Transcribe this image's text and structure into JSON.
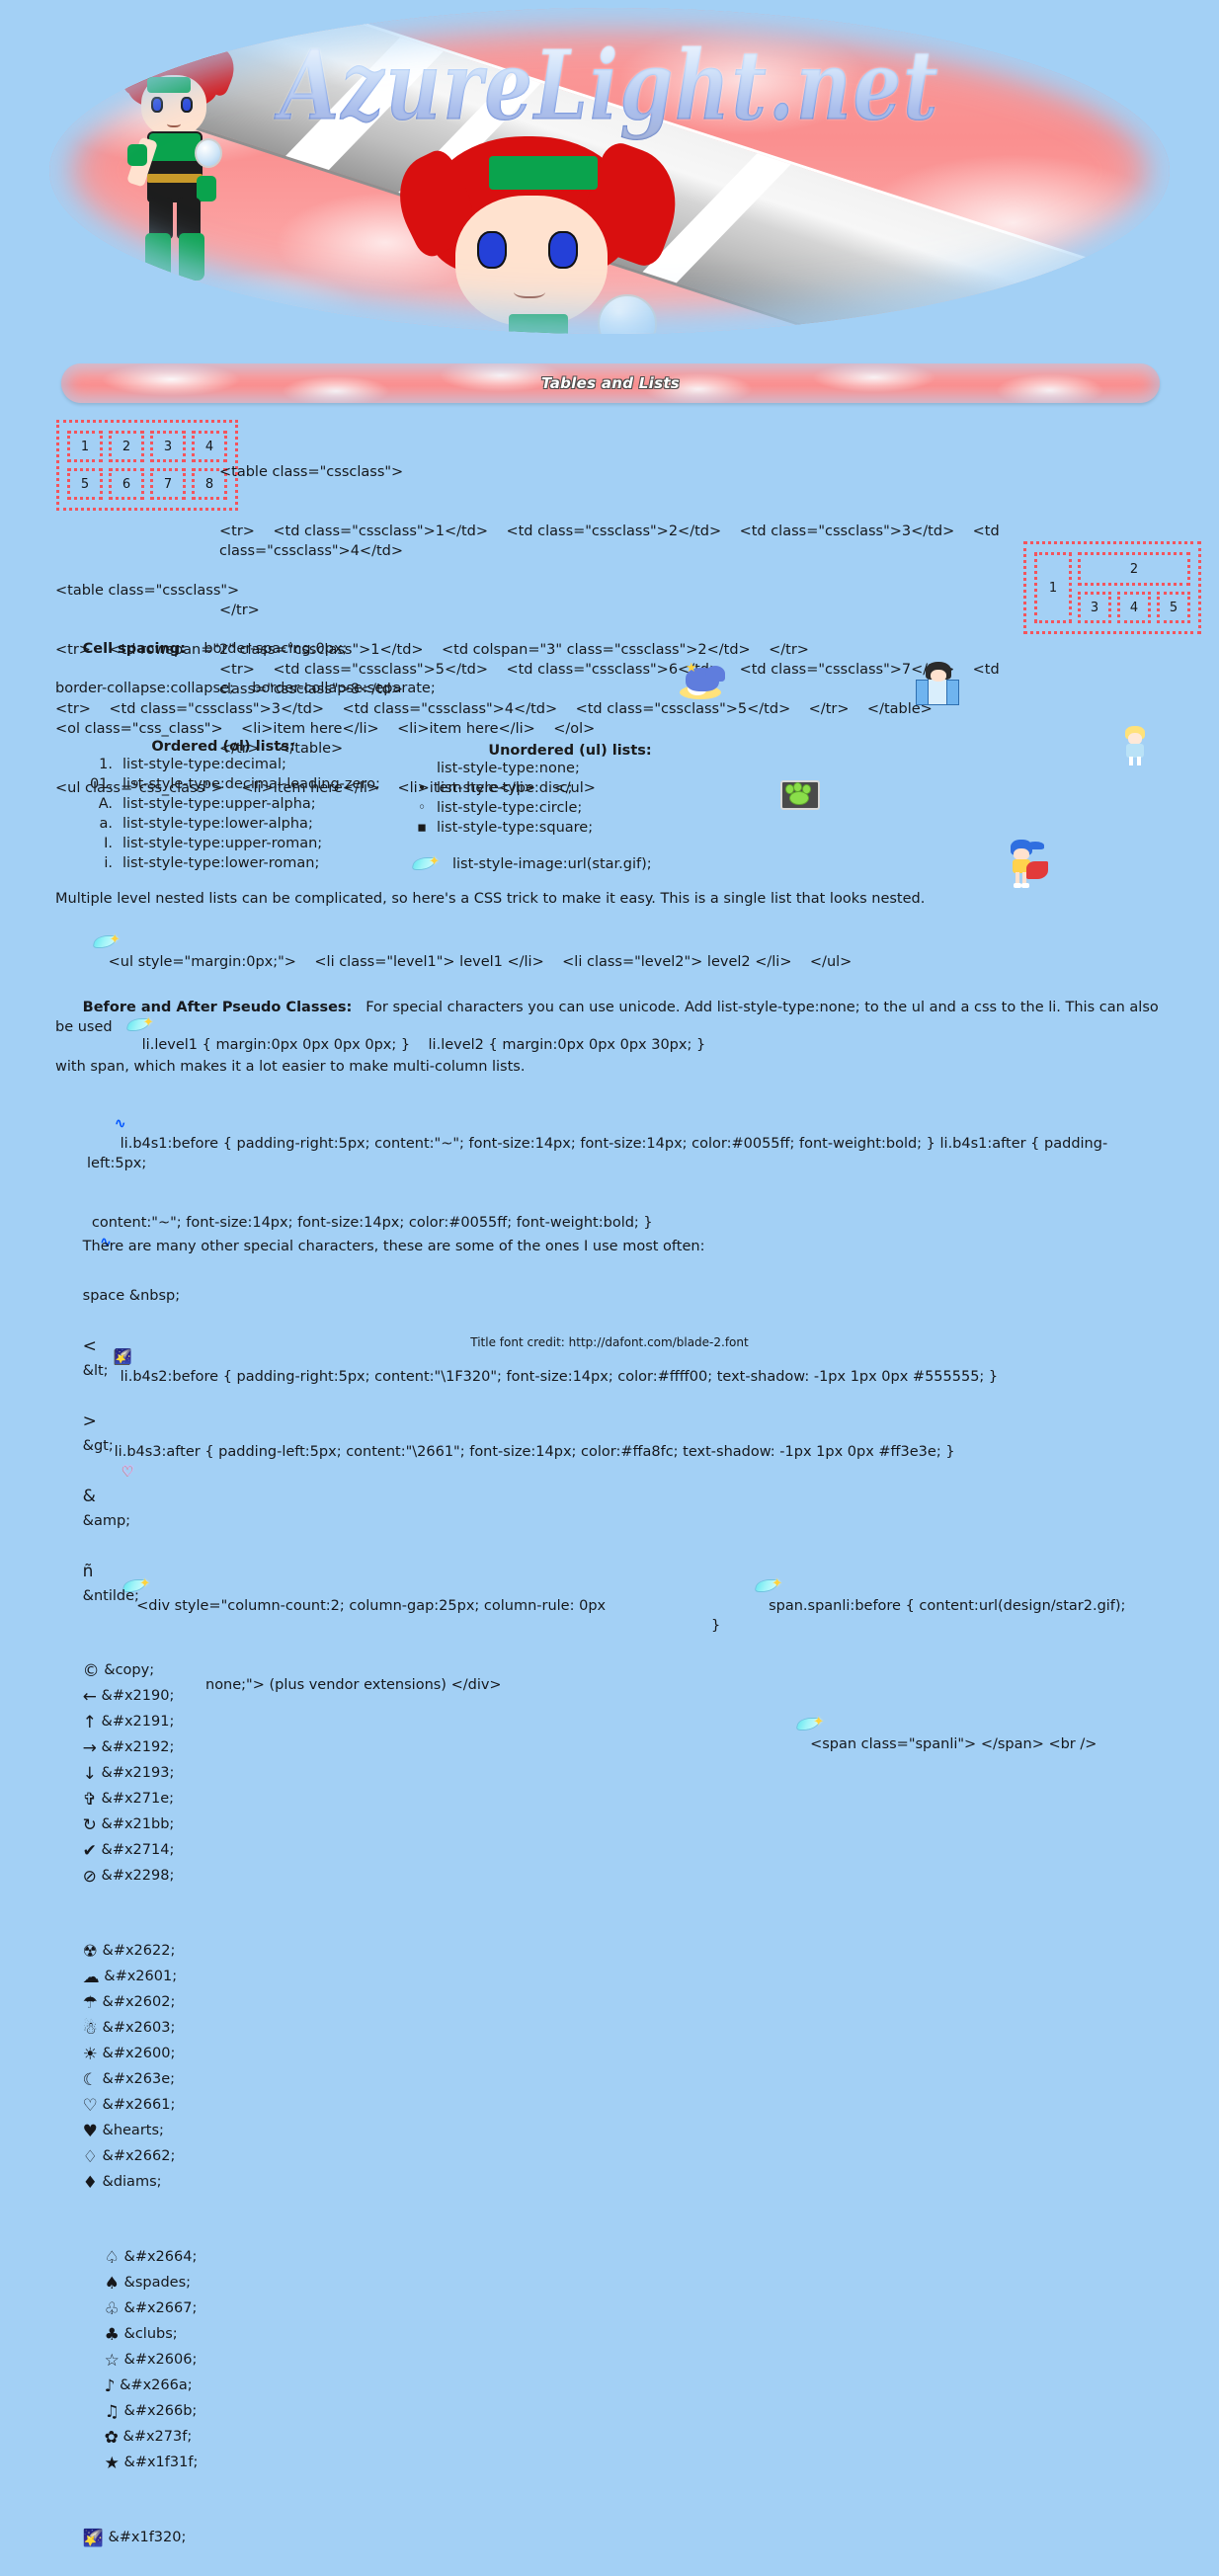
{
  "site": {
    "title": "AzureLight.net",
    "background_color": "#a3d0f5",
    "banner_accent": "#fb9d9d",
    "title_color": "#2f5fd0"
  },
  "section": {
    "title": "Tables and Lists"
  },
  "diagram1": {
    "rows": [
      [
        "1",
        "2",
        "3",
        "4"
      ],
      [
        "5",
        "6",
        "7",
        "8"
      ]
    ],
    "border_color": "#f4545c"
  },
  "diagram2": {
    "left_cell": "1",
    "wide_cell": "2",
    "sub_cells": [
      "3",
      "4",
      "5"
    ],
    "border_color": "#f4545c"
  },
  "code_block1": {
    "line1": "<table class=\"cssclass\">",
    "line2": "<tr>    <td class=\"cssclass\">1</td>    <td class=\"cssclass\">2</td>    <td class=\"cssclass\">3</td>    <td class=\"cssclass\">4</td>",
    "line3": "</tr>",
    "line4": "<tr>    <td class=\"cssclass\">5</td>    <td class=\"cssclass\">6</td>    <td class=\"cssclass\">7</td>    <td class=\"cssclass\">8</td>",
    "line5": "</tr>    </table>"
  },
  "code_block2": {
    "line1": "<table class=\"cssclass\">",
    "line2": "<tr>    <td rowspan=\"2\" class=\"cssclass\">1</td>    <td colspan=\"3\" class=\"cssclass\">2</td>    </tr>",
    "line3": "<tr>    <td class=\"cssclass\">3</td>    <td class=\"cssclass\">4</td>    <td class=\"cssclass\">5</td>    </tr>    </table>"
  },
  "cell_spacing": {
    "label": "Cell spacing:",
    "value1": "border-spacing:0px;",
    "line2": "border-collapse:collapse;    border-collapse:separate;"
  },
  "code_block3": {
    "line1": "<ol class=\"css_class\">    <li>item here</li>    <li>item here</li>    </ol>",
    "line2": "<ul class=\"css_class\">    <li>item here</li>    <li>item here</li>    </ul>"
  },
  "ordered_lists": {
    "heading": "Ordered (ol) lists:",
    "items": [
      {
        "marker": "1.",
        "text": "list-style-type:decimal;"
      },
      {
        "marker": "01.",
        "text": "list-style-type:decimal-leading-zero;"
      },
      {
        "marker": "A.",
        "text": "list-style-type:upper-alpha;"
      },
      {
        "marker": "a.",
        "text": "list-style-type:lower-alpha;"
      },
      {
        "marker": "I.",
        "text": "list-style-type:upper-roman;"
      },
      {
        "marker": "i.",
        "text": "list-style-type:lower-roman;"
      }
    ]
  },
  "unordered_lists": {
    "heading": "Unordered (ul) lists:",
    "items": [
      {
        "marker": "",
        "text": "list-style-type:none;"
      },
      {
        "marker": "•",
        "text": "list-style-type:disc;"
      },
      {
        "marker": "◦",
        "text": "list-style-type:circle;"
      },
      {
        "marker": "▪",
        "text": "list-style-type:square;"
      }
    ],
    "image_item": {
      "marker": "star-icon",
      "text": "list-style-image:url(star.gif);"
    }
  },
  "nested": {
    "intro": "Multiple level nested lists can be complicated, so here's a CSS trick to make it easy. This is a single list that looks nested.",
    "line1": "<ul style=\"margin:0px;\">    <li class=\"level1\"> level1 </li>    <li class=\"level2\"> level2 </li>    </ul>",
    "line2": "li.level1 { margin:0px 0px 0px 0px; }    li.level2 { margin:0px 0px 0px 30px; }"
  },
  "pseudo": {
    "heading": "Before and After Pseudo Classes:",
    "intro1": "For special characters you can use unicode. Add list-style-type:none; to the ul and a css to the li. This can also be used",
    "intro2": "with span, which makes it a lot easier to make multi-column lists.",
    "b4s1_glyph": "∿",
    "b4s1_line1": "li.b4s1:before { padding-right:5px; content:\"~\"; font-size:14px; font-size:14px; color:#0055ff; font-weight:bold; } li.b4s1:after { padding-left:5px;",
    "b4s1_line2": "content:\"~\"; font-size:14px; font-size:14px; color:#0055ff; font-weight:bold; }",
    "b4s2_line": "li.b4s2:before { padding-right:5px; content:\"\\1F320\"; font-size:14px; color:#ffff00; text-shadow: -1px 1px 0px #555555; }",
    "b4s3_line": "li.b4s3:after { padding-left:5px; content:\"\\2661\"; font-size:14px; color:#ffa8fc; text-shadow: -1px 1px 0px #ff3e3e; }",
    "b4s3_glyph": "♡",
    "column_line1": "<div style=\"column-count:2; column-gap:25px; column-rule: 0px",
    "column_line2": "none;\"> (plus vendor extensions) </div>",
    "spanli_line1": "span.spanli:before { content:url(design/star2.gif); }",
    "spanli_line2": "<span class=\"spanli\"> </span> <br />"
  },
  "special_chars": {
    "intro": "There are many other special characters, these are some of the ones I use most often:",
    "inline": [
      {
        "glyph": "",
        "code": "space &nbsp;"
      },
      {
        "glyph": "<",
        "code": "&lt;"
      },
      {
        "glyph": ">",
        "code": "&gt;"
      },
      {
        "glyph": "&",
        "code": "&amp;"
      },
      {
        "glyph": "ñ",
        "code": "&ntilde;"
      }
    ],
    "row2": [
      {
        "glyph": "©",
        "code": "&copy;"
      },
      {
        "glyph": "←",
        "code": "&#x2190;"
      },
      {
        "glyph": "↑",
        "code": "&#x2191;"
      },
      {
        "glyph": "→",
        "code": "&#x2192;"
      },
      {
        "glyph": "↓",
        "code": "&#x2193;"
      },
      {
        "glyph": "✞",
        "code": "&#x271e;"
      },
      {
        "glyph": "↻",
        "code": "&#x21bb;"
      },
      {
        "glyph": "✔",
        "code": "&#x2714;"
      },
      {
        "glyph": "⊘",
        "code": "&#x2298;"
      }
    ],
    "row3": [
      {
        "glyph": "☢",
        "code": "&#x2622;"
      },
      {
        "glyph": "☁",
        "code": "&#x2601;"
      },
      {
        "glyph": "☂",
        "code": "&#x2602;"
      },
      {
        "glyph": "☃",
        "code": "&#x2603;"
      },
      {
        "glyph": "☀",
        "code": "&#x2600;"
      },
      {
        "glyph": "☾",
        "code": "&#x263e;"
      },
      {
        "glyph": "♡",
        "code": "&#x2661;"
      },
      {
        "glyph": "♥",
        "code": "&hearts;"
      },
      {
        "glyph": "♢",
        "code": "&#x2662;"
      },
      {
        "glyph": "♦",
        "code": "&diams;"
      }
    ],
    "row4": [
      {
        "glyph": "♤",
        "code": "&#x2664;"
      },
      {
        "glyph": "♠",
        "code": "&spades;"
      },
      {
        "glyph": "♧",
        "code": "&#x2667;"
      },
      {
        "glyph": "♣",
        "code": "&clubs;"
      },
      {
        "glyph": "☆",
        "code": "&#x2606;"
      },
      {
        "glyph": "♪",
        "code": "&#x266a;"
      },
      {
        "glyph": "♫",
        "code": "&#x266b;"
      },
      {
        "glyph": "✿",
        "code": "&#x273f;"
      },
      {
        "glyph": "★",
        "code": "&#x1f31f;"
      }
    ],
    "row5": [
      {
        "glyph": "🌠",
        "code": "&#x1f320;"
      }
    ]
  },
  "footer": {
    "credit": "Title font credit: http://dafont.com/blade-2.font"
  }
}
